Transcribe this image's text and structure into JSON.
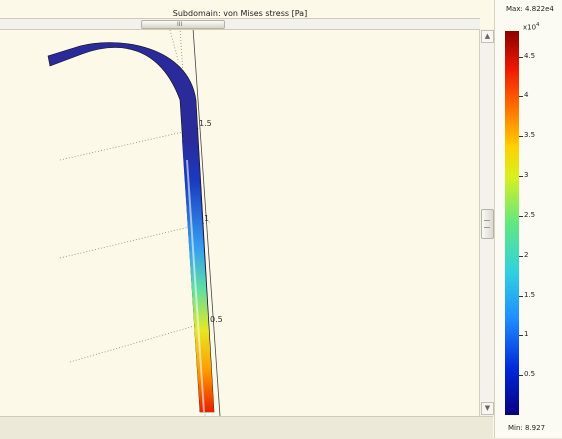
{
  "title": "Subdomain: von Mises stress [Pa]",
  "scrollbar_grip": "III",
  "colorbar": {
    "max_label": "Max: 4.822e4",
    "min_label": "Min: 8.927",
    "multiplier_base": "x10",
    "multiplier_exp": "4",
    "ticks": [
      "4.5",
      "4",
      "3.5",
      "3",
      "2.5",
      "2",
      "1.5",
      "1",
      "0.5"
    ]
  },
  "axis_ticks": [
    "1.5",
    "1",
    "0.5"
  ],
  "colors": {
    "background": "#fdf9e8",
    "tube": "#2a2a9a"
  }
}
